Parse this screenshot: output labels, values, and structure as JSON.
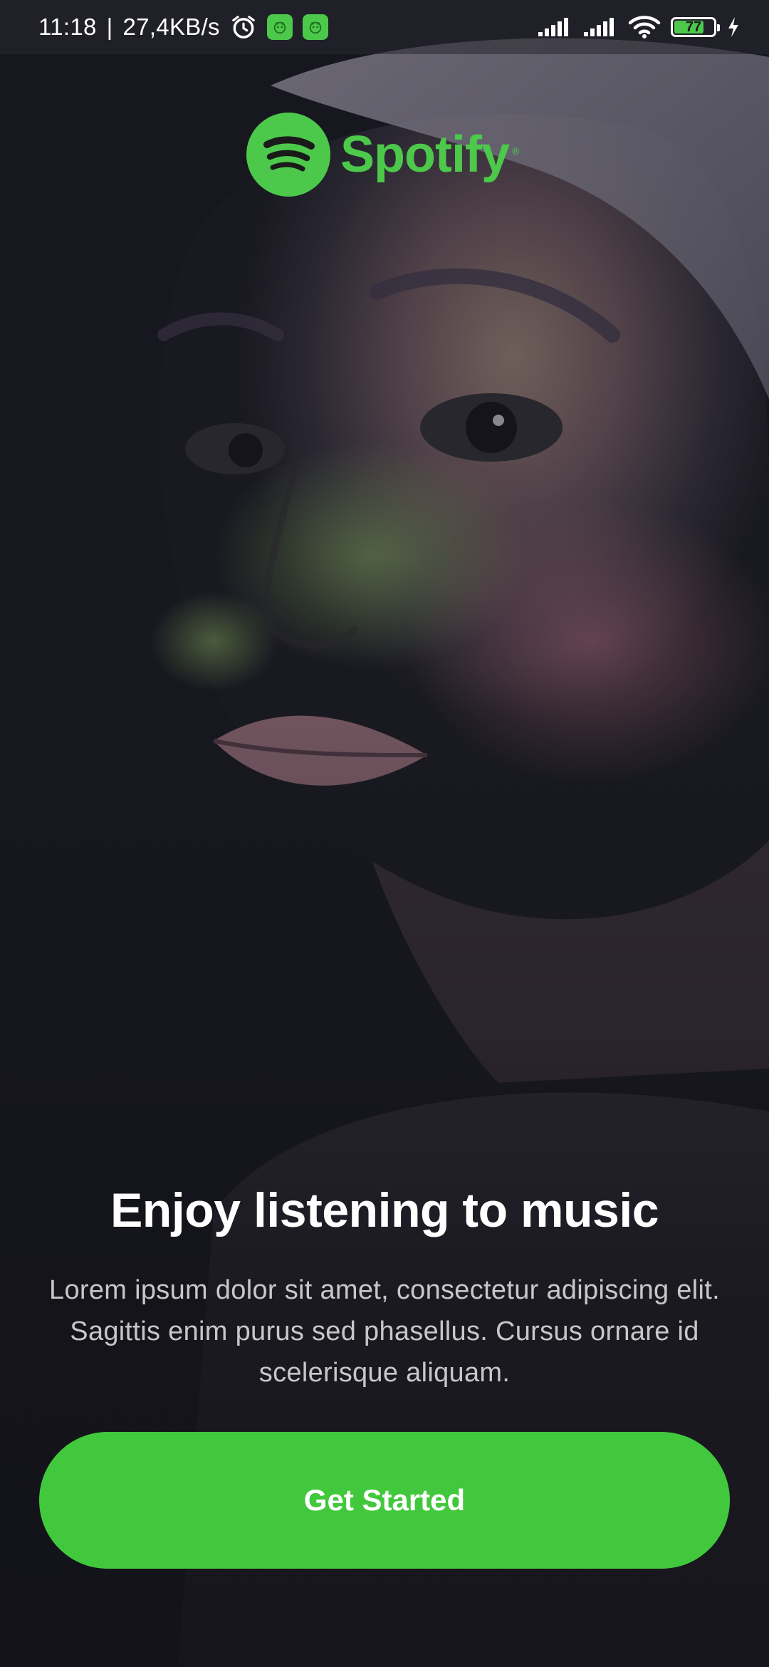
{
  "status_bar": {
    "time": "11:18",
    "separator": "|",
    "speed": "27,4KB/s",
    "battery_level": "77",
    "battery_fraction": 0.77,
    "icons": [
      "alarm-icon",
      "app-badge-icon",
      "app-badge-icon",
      "signal-icon",
      "signal-icon",
      "wifi-icon",
      "battery-icon",
      "charging-icon"
    ]
  },
  "brand": {
    "name": "Spotify",
    "registered_mark": "®",
    "color": "#4cc94b"
  },
  "onboarding": {
    "headline": "Enjoy listening to music",
    "body": "Lorem ipsum dolor sit amet, consectetur adipiscing elit. Sagittis enim purus sed phasellus. Cursus ornare id scelerisque aliquam.",
    "cta_label": "Get Started",
    "cta_color": "#42c83c"
  },
  "background": {
    "description_icon": "portrait-photo"
  }
}
